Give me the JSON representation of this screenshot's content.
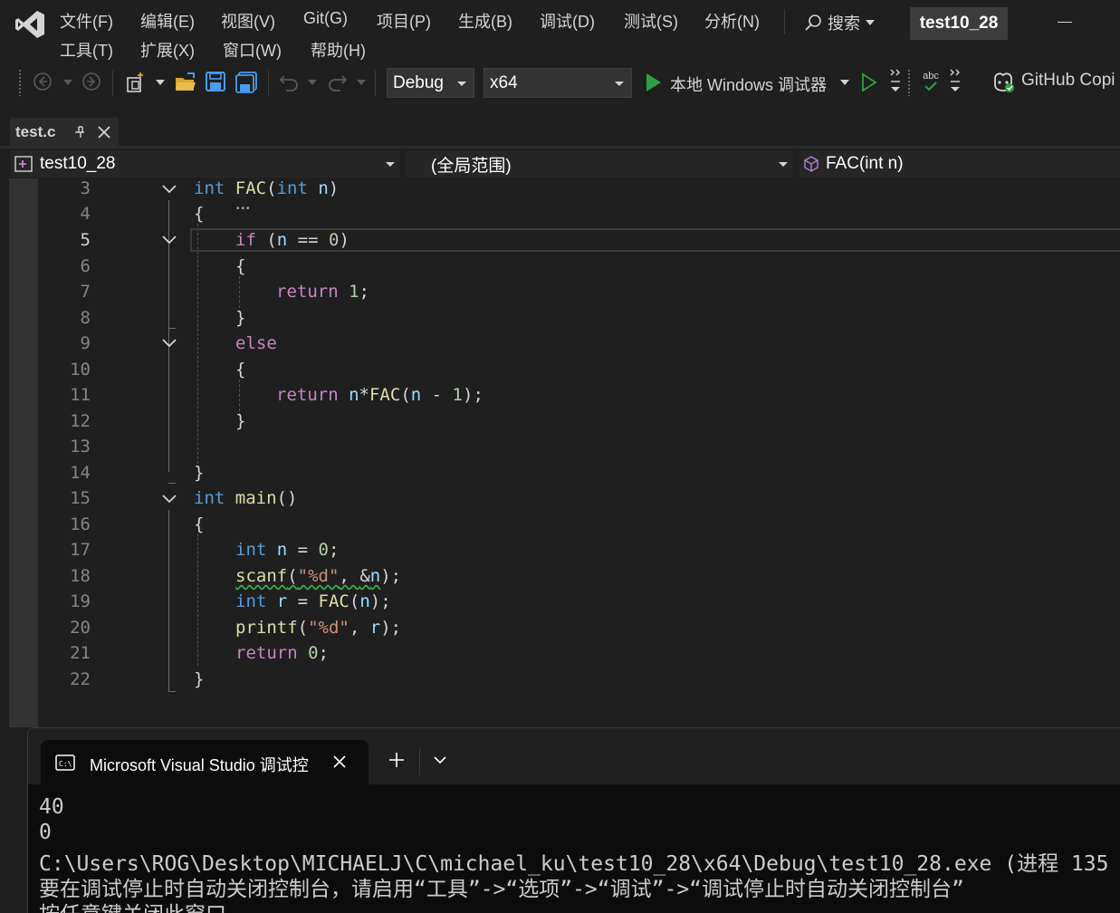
{
  "app": {
    "solution_name": "test10_28"
  },
  "menu": {
    "row1": [
      "文件(F)",
      "编辑(E)",
      "视图(V)",
      "Git(G)",
      "项目(P)",
      "生成(B)",
      "调试(D)",
      "测试(S)",
      "分析(N)"
    ],
    "row2": [
      "工具(T)",
      "扩展(X)",
      "窗口(W)",
      "帮助(H)"
    ],
    "search_label": "搜索"
  },
  "toolbar": {
    "configuration": "Debug",
    "platform": "x64",
    "run_debugger_label": "本地 Windows 调试器",
    "copilot_label": "GitHub Copi",
    "spellcheck_label": "abc"
  },
  "editor_tab": {
    "filename": "test.c"
  },
  "navbar": {
    "project": "test10_28",
    "scope": "(全局范围)",
    "member": "FAC(int n)"
  },
  "code": {
    "current_line": 5,
    "line_numbers": [
      "3",
      "4",
      "5",
      "6",
      "7",
      "8",
      "9",
      "10",
      "11",
      "12",
      "13",
      "14",
      "15",
      "16",
      "17",
      "18",
      "19",
      "20",
      "21",
      "22"
    ],
    "lines": {
      "l3": {
        "kw": "int",
        "fn": "FAC",
        "p1": "(",
        "kw2": "int",
        "var": " n",
        "p2": ")"
      },
      "l4": "{",
      "l5": {
        "kw": "if",
        "p1": " (",
        "var": "n",
        "op": " == ",
        "num": "0",
        "p2": ")"
      },
      "l6": "{",
      "l7": {
        "kw": "return",
        "num": " 1",
        "p": ";"
      },
      "l8": "}",
      "l9": {
        "kw": "else"
      },
      "l10": "{",
      "l11": {
        "kw": "return",
        "var": " n",
        "op": "*",
        "fn": "FAC",
        "p1": "(",
        "var2": "n",
        "op2": " - ",
        "num": "1",
        "p2": ");"
      },
      "l12": "}",
      "l14": "}",
      "l15": {
        "kw": "int",
        "fn": " main",
        "p": "()"
      },
      "l16": "{",
      "l17": {
        "kw": "int",
        "var": " n",
        "op": " = ",
        "num": "0",
        "p": ";"
      },
      "l18": {
        "fn": "scanf",
        "p1": "(",
        "str": "\"%d\"",
        "p2": ", ",
        "amp": "&",
        "var": "n",
        "p3": ");"
      },
      "l19": {
        "kw": "int",
        "var": " r",
        "op": " = ",
        "fn": "FAC",
        "p1": "(",
        "var2": "n",
        "p2": ");"
      },
      "l20": {
        "fn": "printf",
        "p1": "(",
        "str": "\"%d\"",
        "p2": ", ",
        "var": "r",
        "p3": ");"
      },
      "l21": {
        "kw": "return",
        "num": " 0",
        "p": ";"
      },
      "l22": "}"
    }
  },
  "console": {
    "tab_title": "Microsoft Visual Studio 调试控",
    "output": [
      "40",
      "0",
      "C:\\Users\\ROG\\Desktop\\MICHAELJ\\C\\michael_ku\\test10_28\\x64\\Debug\\test10_28.exe (进程 135",
      "要在调试停止时自动关闭控制台，请启用“工具”->“选项”->“调试”->“调试停止时自动关闭控制台”",
      "按任意键关闭此窗口. . ."
    ]
  },
  "colors": {
    "keyword": "#569cd6",
    "control_keyword": "#c586c0",
    "function": "#dcdcaa",
    "variable": "#9cdcfe",
    "number": "#b5cea8",
    "string": "#ce9178",
    "run_green": "#2ea043",
    "background": "#1f1f1f"
  }
}
